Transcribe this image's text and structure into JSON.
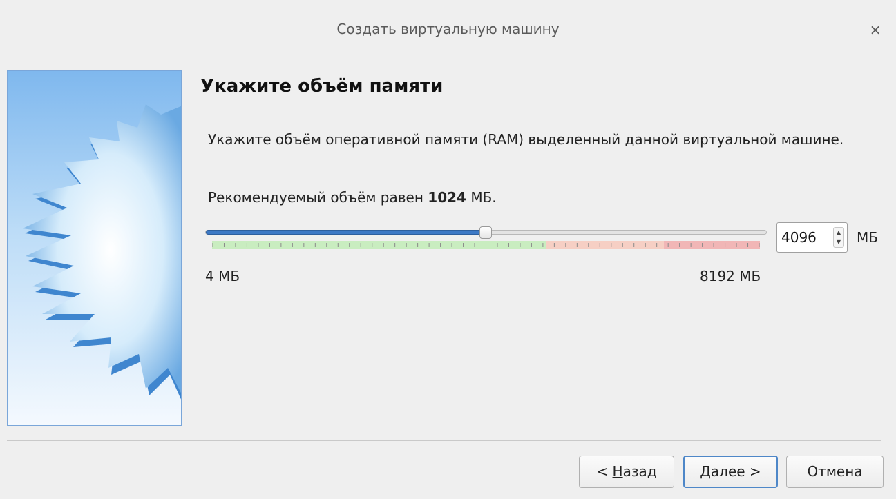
{
  "window": {
    "title": "Создать виртуальную машину",
    "close_glyph": "×"
  },
  "page": {
    "heading": "Укажите объём памяти",
    "description": "Укажите объём оперативной памяти (RAM) выделенный данной виртуальной машине.",
    "recommend_prefix": "Рекомендуемый объём равен",
    "recommend_value": "1024",
    "recommend_suffix": "МБ."
  },
  "memory": {
    "min_label": "4 МБ",
    "max_label": "8192 МБ",
    "value": "4096",
    "unit": "МБ",
    "min_mb": 4,
    "max_mb": 8192,
    "value_mb": 4096,
    "safe_limit_mb": 5000,
    "warn_limit_mb": 6760,
    "colors": {
      "fill": "#3d79c5",
      "safe": "#c9edc0",
      "warn": "#f6cfc4",
      "danger": "#f1b6b6"
    }
  },
  "buttons": {
    "back_prefix": "< ",
    "back_mnemonic": "Н",
    "back_rest": "азад",
    "next_mnemonic": "Д",
    "next_rest": "алее >",
    "cancel": "Отмена"
  },
  "side_image": {
    "icon": "virtualbox-star-wizard-image"
  }
}
